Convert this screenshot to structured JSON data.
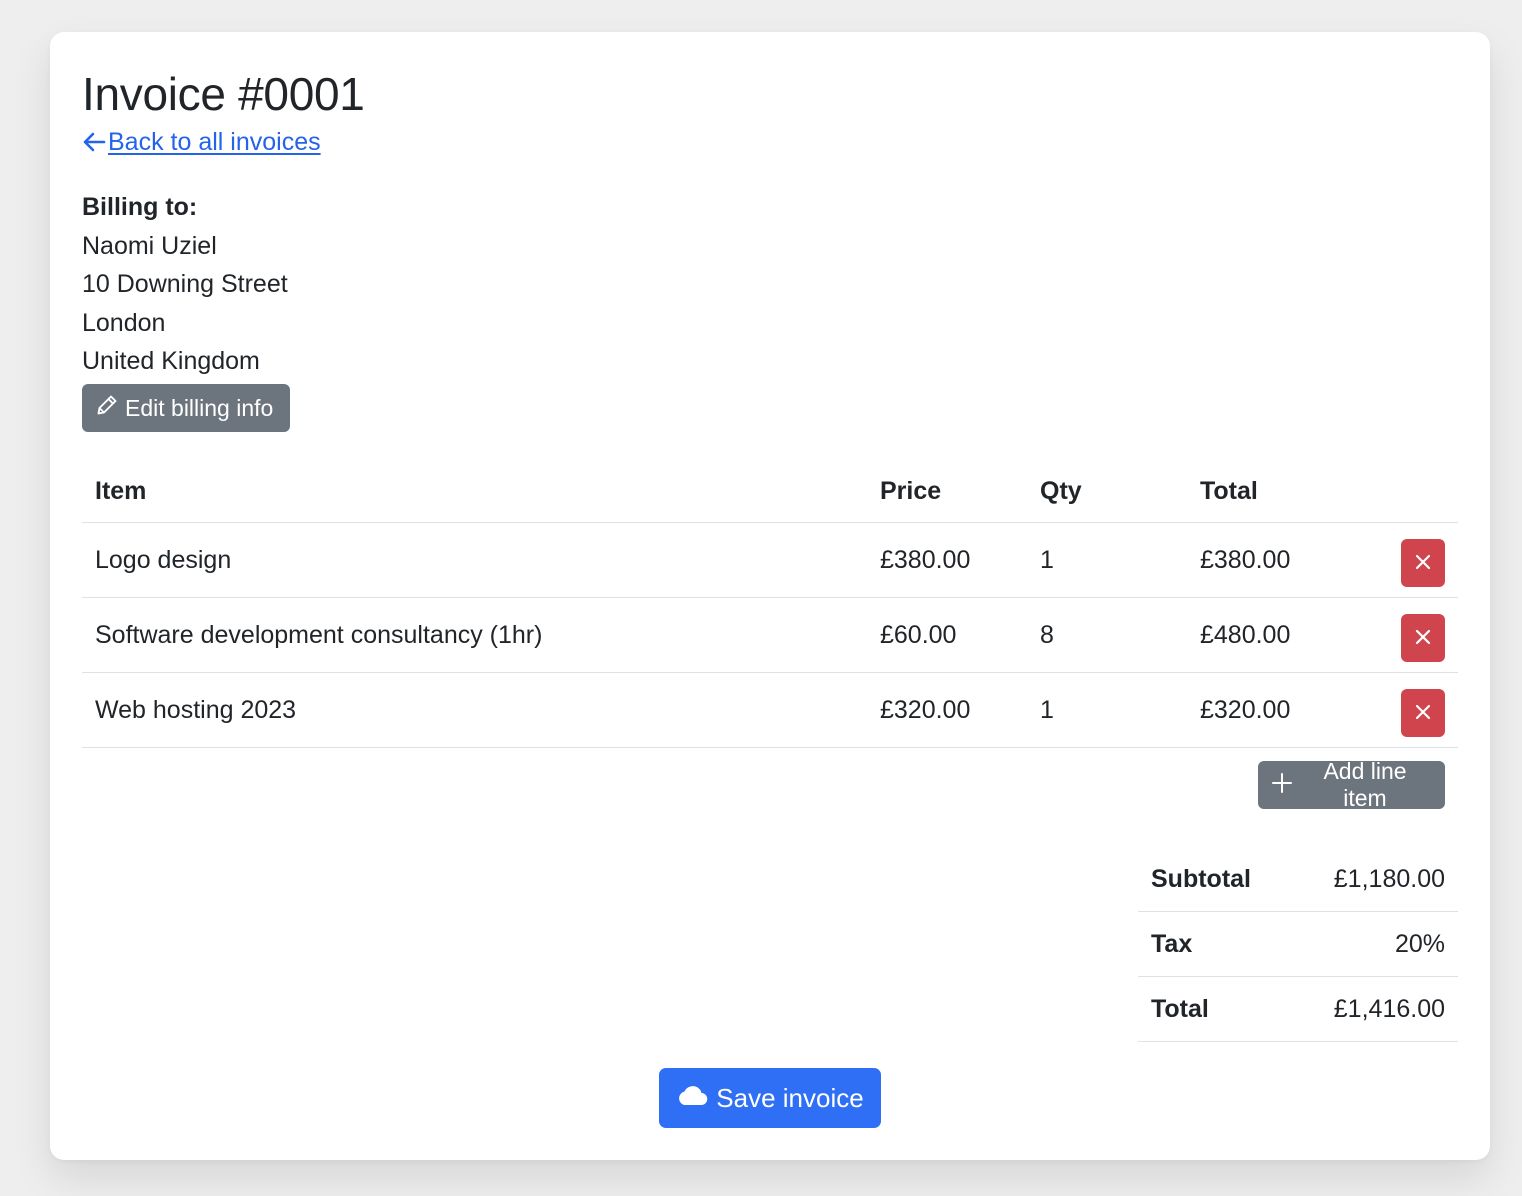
{
  "page": {
    "title": "Invoice #0001",
    "back_link": "Back to all invoices",
    "back_icon": "arrow-left-icon"
  },
  "billing": {
    "label": "Billing to:",
    "name": "Naomi Uziel",
    "address_line1": "10 Downing Street",
    "city": "London",
    "country": "United Kingdom",
    "edit_button": "Edit billing info",
    "edit_icon": "pencil-icon"
  },
  "items_table": {
    "headers": [
      "Item",
      "Price",
      "Qty",
      "Total"
    ],
    "rows": [
      {
        "item": "Logo design",
        "price": "£380.00",
        "qty": "1",
        "total": "£380.00"
      },
      {
        "item": "Software development consultancy (1hr)",
        "price": "£60.00",
        "qty": "8",
        "total": "£480.00"
      },
      {
        "item": "Web hosting 2023",
        "price": "£320.00",
        "qty": "1",
        "total": "£320.00"
      }
    ],
    "delete_icon": "close-icon",
    "add_button": "Add line item",
    "add_icon": "plus-icon"
  },
  "totals": {
    "subtotal_label": "Subtotal",
    "subtotal_value": "£1,180.00",
    "tax_label": "Tax",
    "tax_value": "20%",
    "total_label": "Total",
    "total_value": "£1,416.00"
  },
  "actions": {
    "save_button": "Save invoice",
    "save_icon": "cloud-icon"
  },
  "colors": {
    "background": "#eeeeee",
    "card": "#ffffff",
    "link": "#2563eb",
    "secondary_button": "#6c757d",
    "danger_button": "#d0444d",
    "primary_button": "#2f6ff5",
    "text": "#212529"
  }
}
